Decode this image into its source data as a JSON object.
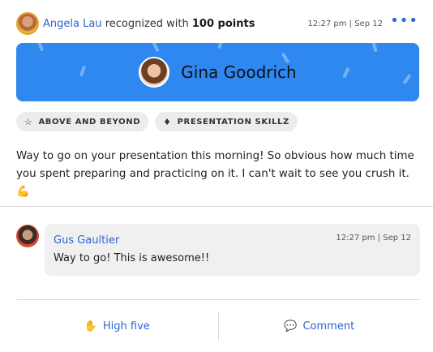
{
  "post": {
    "giver": "Angela Lau",
    "action_text": "recognized with",
    "points": "100 points",
    "time": "12:27 pm | Sep 12",
    "more_icon": "ellipsis-icon"
  },
  "banner": {
    "recipient": "Gina Goodrich",
    "color": "#2f87f0"
  },
  "tags": [
    {
      "icon": "star-icon",
      "glyph": "☆",
      "label": "ABOVE AND BEYOND"
    },
    {
      "icon": "diamond-icon",
      "glyph": "♦",
      "label": "PRESENTATION SKILLZ"
    }
  ],
  "message": "Way to go on your presentation this morning! So obvious how much time you spent preparing and practicing on it. I can't wait to see you crush it. 💪",
  "comment": {
    "author": "Gus Gaultier",
    "time": "12:27 pm | Sep 12",
    "text": "Way to go! This is awesome!!"
  },
  "actions": {
    "high_five": "High five",
    "comment": "Comment"
  },
  "colors": {
    "accent": "#2f63d6",
    "banner": "#2f87f0"
  }
}
